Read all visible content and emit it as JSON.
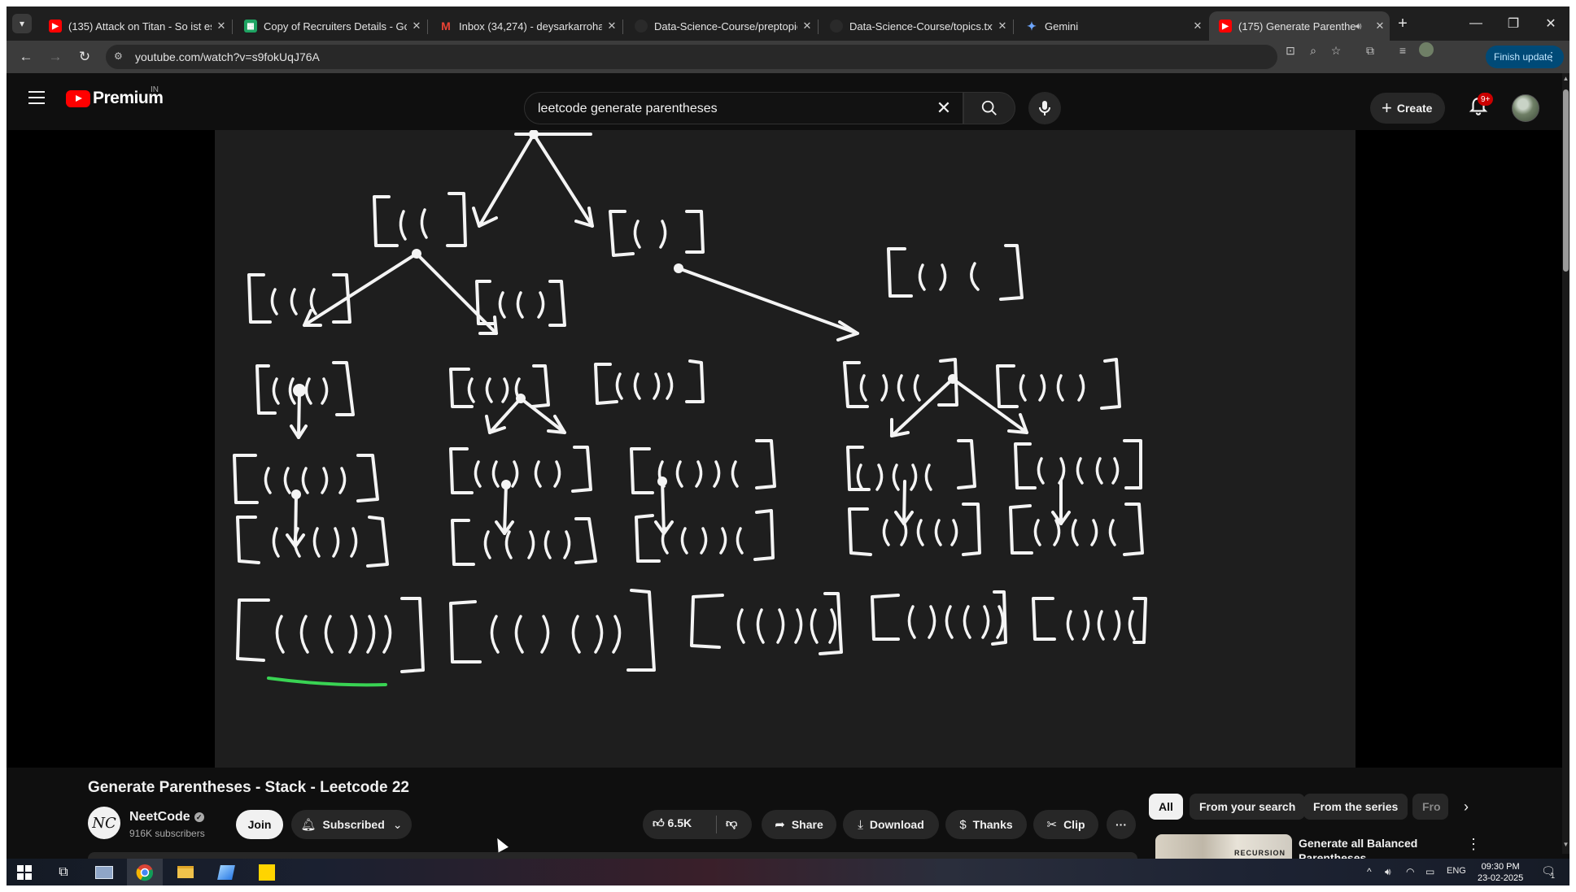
{
  "browser": {
    "tabs": [
      {
        "title": "(135) Attack on Titan - So ist es",
        "favicon": "youtube-icon"
      },
      {
        "title": "Copy of Recruiters Details - Go",
        "favicon": "sheets-icon"
      },
      {
        "title": "Inbox (34,274) - deysarkarroha",
        "favicon": "gmail-icon"
      },
      {
        "title": "Data-Science-Course/preptopic",
        "favicon": "github-icon"
      },
      {
        "title": "Data-Science-Course/topics.txt",
        "favicon": "github-icon"
      },
      {
        "title": "Gemini",
        "favicon": "gemini-icon"
      },
      {
        "title": "(175) Generate Parenthese",
        "favicon": "youtube-icon",
        "active": true,
        "audio": true
      }
    ],
    "url": "youtube.com/watch?v=s9fokUqJ76A",
    "finish_update_label": "Finish update"
  },
  "youtube": {
    "logo_text": "Premium",
    "country_code": "IN",
    "search_query": "leetcode generate parentheses",
    "create_label": "Create",
    "notification_count": "9+"
  },
  "video": {
    "title": "Generate Parentheses - Stack - Leetcode 22",
    "channel": {
      "name": "NeetCode",
      "subscribers": "916K subscribers",
      "avatar_text": "NC"
    },
    "join_label": "Join",
    "subscribed_label": "Subscribed",
    "like_count": "6.5K",
    "share_label": "Share",
    "download_label": "Download",
    "thanks_label": "Thanks",
    "clip_label": "Clip",
    "whiteboard_nodes": [
      "[(((]",
      "[(()]",
      "[()]",
      "[(((]",
      "[(()]",
      "[()(]",
      "[((()]",
      "[(()(]",
      "[(())]",
      "[()((]",
      "[()()]",
      "[((())]",
      "[(()()]",
      "[(())(]",
      "[()(()]",
      "[()()(]",
      "[((()))]",
      "[(()())]",
      "[(())()]",
      "[()(())]",
      "[()()()]"
    ]
  },
  "sidebar": {
    "chips": [
      "All",
      "From your search",
      "From the series",
      "Fro"
    ],
    "recommendation": {
      "title": "Generate all Balanced Parentheses",
      "thumb_text": "RECURSION"
    }
  },
  "taskbar": {
    "language": "ENG",
    "time": "09:30 PM",
    "date": "23-02-2025",
    "notification_count": "1"
  }
}
